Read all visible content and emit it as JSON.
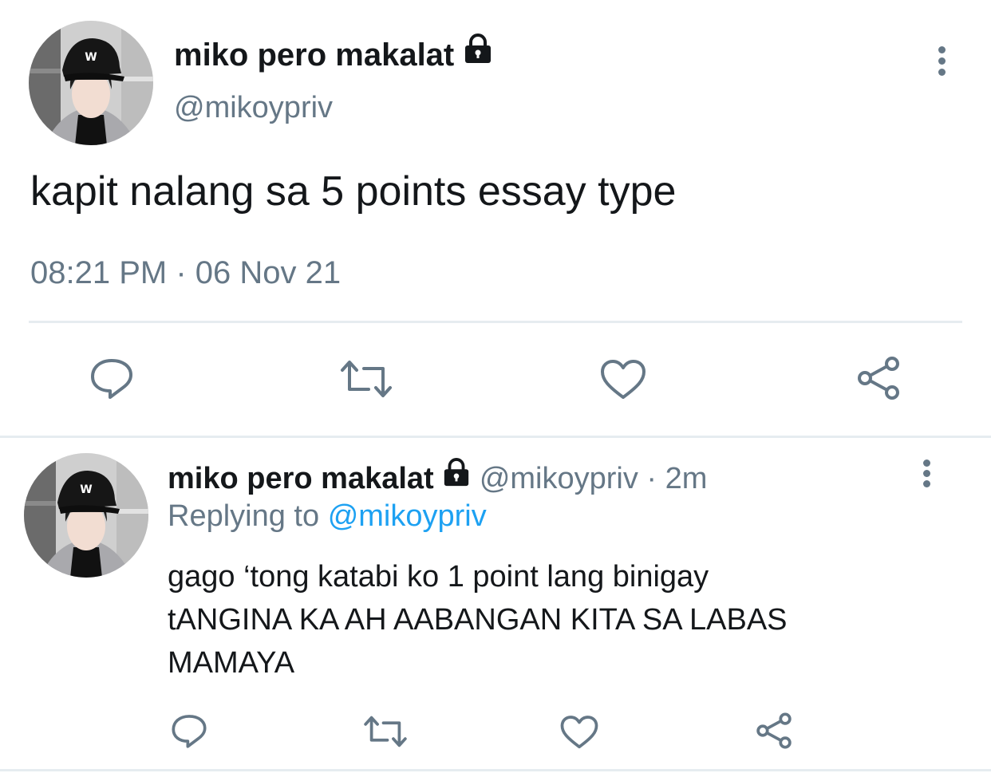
{
  "main_tweet": {
    "display_name": "miko pero makalat",
    "handle": "@mikoypriv",
    "text": "kapit nalang sa 5 points essay type",
    "timestamp": "08:21 PM · 06 Nov 21",
    "icons": [
      "reply-icon",
      "retweet-icon",
      "like-icon",
      "share-icon",
      "more-options-icon",
      "lock-icon"
    ]
  },
  "reply_tweet": {
    "display_name": "miko pero makalat",
    "handle_time": "@mikoypriv · 2m",
    "replying_prefix": "Replying to",
    "replying_handle": "@mikoypriv",
    "text_line1": "gago ‘tong katabi ko 1 point lang binigay",
    "text_line2": "tANGINA KA AH AABANGAN KITA SA LABAS",
    "text_line3": "MAMAYA",
    "icons": [
      "reply-icon",
      "retweet-icon",
      "like-icon",
      "share-icon",
      "more-options-icon",
      "lock-icon"
    ]
  },
  "colors": {
    "text": "#14171a",
    "muted": "#657786",
    "link": "#1da1f2",
    "divider": "#e6ecf0"
  }
}
